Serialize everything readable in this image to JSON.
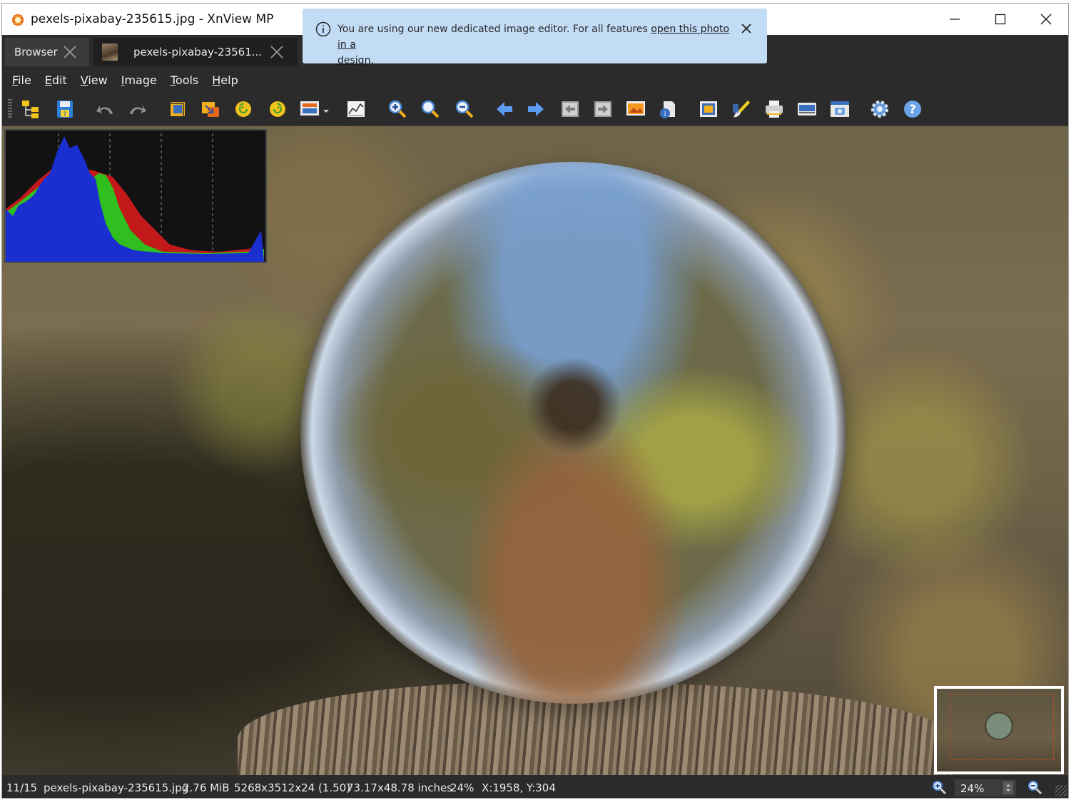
{
  "window": {
    "title": "pexels-pixabay-235615.jpg - XnView MP"
  },
  "tabs": [
    {
      "label": "Browser"
    },
    {
      "label": "pexels-pixabay-23561..."
    }
  ],
  "notification": {
    "text": "You are using our new dedicated image editor. For all features ",
    "link_part1": "open this photo in a",
    "link_part2": "design",
    "suffix": "."
  },
  "menu": [
    {
      "label": "File",
      "accel": "F",
      "rest": "ile"
    },
    {
      "label": "Edit",
      "accel": "E",
      "rest": "dit"
    },
    {
      "label": "View",
      "accel": "V",
      "rest": "iew"
    },
    {
      "label": "Image",
      "accel": "I",
      "rest": "mage"
    },
    {
      "label": "Tools",
      "accel": "T",
      "rest": "ools"
    },
    {
      "label": "Help",
      "accel": "H",
      "rest": "elp"
    }
  ],
  "toolbar": {
    "icons": [
      "browser-folder-icon",
      "save-icon",
      "undo-icon",
      "redo-icon",
      "crop-icon",
      "resize-icon",
      "rotate-left-icon",
      "rotate-right-icon",
      "adjust-dropdown-icon",
      "levels-icon",
      "zoom-in-icon",
      "zoom-fit-icon",
      "zoom-out-icon",
      "previous-icon",
      "next-icon",
      "first-icon",
      "last-icon",
      "slideshow-icon",
      "properties-icon",
      "fullscreen-icon",
      "edit-brush-icon",
      "print-icon",
      "scanner-icon",
      "capture-icon",
      "settings-icon",
      "help-icon"
    ]
  },
  "status": {
    "index": "11/15",
    "filename": "pexels-pixabay-235615.jpg",
    "filesize": "2.76 MiB",
    "dimensions": "5268x3512x24 (1.50)",
    "print_size": "73.17x48.78 inches",
    "zoom_percent": "24%",
    "cursor": "X:1958, Y:304",
    "zoom_box": "24%"
  },
  "colors": {
    "notification_bg": "#c2dcf6",
    "chrome_bg": "#2b2b2b",
    "histogram_blue": "#1a2fd0",
    "histogram_green": "#2fbf1e",
    "histogram_red": "#c4191a"
  }
}
